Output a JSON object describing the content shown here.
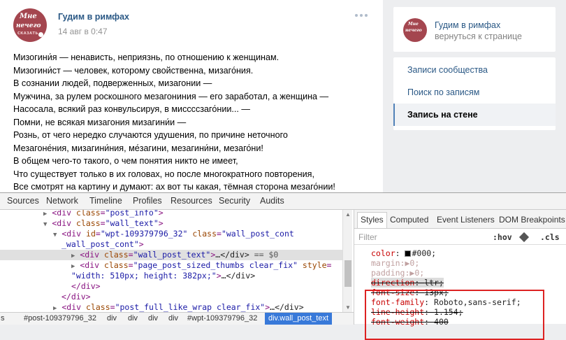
{
  "post": {
    "author": "Гудим в римфах",
    "date": "14 авг в 0:47",
    "lines": [
      "Мизогини́я — ненависть, неприязнь, по отношению к женщинам.",
      "Мизогини́ст — человек, которому свойственна, мизаго́ния.",
      "В сознании людей, подверженных, мизагонии —",
      "Мужчина, за рулем роскошного мезагониния — его заработал, а женщина —",
      "Насосала, всякий раз конвульсируя, в миссссзаго́нии... —",
      "Помни, не всякая мизагония мизагини́и —",
      "Рознь, от чего нередко случаются удушения, по причине неточного",
      "Мезагоне́ния, мизагини́ния, ме́загини, мезагини́ни, мезаго́ни!",
      "В общем чего-то такого, о чем понятия никто не имеет,",
      "Что существует только в их головах, но после многократного повторения,",
      "Все смотрят на картину и думают: ах вот ты какая, тёмная сторона мезаго́нии!"
    ],
    "avatar_text": [
      "Мне",
      "нечего",
      "СКАЗАТЬ"
    ]
  },
  "sidebar": {
    "title": "Гудим в римфах",
    "back": "вернуться к странице",
    "items": [
      "Записи сообщества",
      "Поиск по записям",
      "Запись на стене"
    ]
  },
  "devtools": {
    "tabs": [
      "Sources",
      "Network",
      "Timeline",
      "Profiles",
      "Resources",
      "Security",
      "Audits"
    ],
    "dom": {
      "l1_tag": "div",
      "l1_attr": "class",
      "l1_val": "\"post_info\"",
      "l2_tag": "div",
      "l2_attr": "class",
      "l2_val": "\"wall_text\"",
      "l3_tag": "div",
      "l3_attr1": "id",
      "l3_val1": "\"wpt-109379796_32\"",
      "l3_attr2": "class",
      "l3_val2": "\"wall_post_cont",
      "l4_cont": "_wall_post_cont\"",
      "l5_tag": "div",
      "l5_attr": "class",
      "l5_val": "\"wall_post_text\"",
      "l5_tail": "…</div>",
      "l5_eq": "== $0",
      "l6_tag": "div",
      "l6_attr1": "class",
      "l6_val1": "\"page_post_sized_thumbs  clear_fix\"",
      "l6_attr2": "style",
      "l7_val": "\"width: 510px; height: 382px;\"",
      "l7_tail": "…</div>",
      "l8": "</div>",
      "l9": "</div>",
      "l10_tag": "div",
      "l10_attr": "class",
      "l10_val": "\"post_full_like_wrap clear_fix\"",
      "l10_tail": "…</div>"
    },
    "breadcrumbs": [
      "s",
      "#post-109379796_32",
      "div",
      "div",
      "div",
      "div",
      "#wpt-109379796_32",
      "div.wall_post_text"
    ],
    "styles": {
      "tabs": [
        "Styles",
        "Computed",
        "Event Listeners",
        "DOM Breakpoints"
      ],
      "filter_placeholder": "Filter",
      "hov": ":hov",
      "cls": ".cls",
      "decls": [
        {
          "name": "color",
          "value": "#000;"
        },
        {
          "name": "margin",
          "value": "▶0;"
        },
        {
          "name": "padding",
          "value": "▶0;"
        },
        {
          "name": "direction",
          "value": "ltr;"
        },
        {
          "name": "font-size",
          "value": "13px;"
        },
        {
          "name": "font-family",
          "value": "Roboto,sans-serif;"
        },
        {
          "name": "line-height",
          "value": "1.154;"
        },
        {
          "name": "font-weight",
          "value": "400"
        }
      ]
    }
  }
}
